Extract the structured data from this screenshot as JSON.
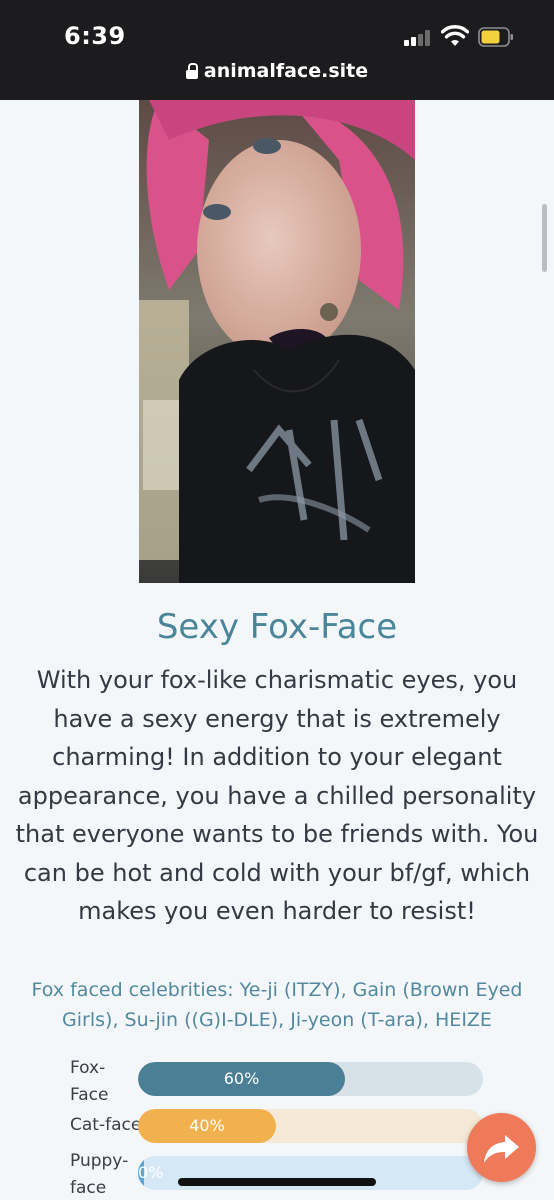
{
  "status_bar": {
    "time": "6:39"
  },
  "browser": {
    "url": "animalface.site"
  },
  "result": {
    "title": "Sexy Fox-Face",
    "description": "With your fox-like charismatic eyes, you have a sexy energy that is extremely charming! In addition to your elegant appearance, you have a chilled personality that everyone wants to be friends with. You can be hot and cold with your bf/gf, which makes you even harder to resist!",
    "celebrities": "Fox faced celebrities: Ye-ji (ITZY), Gain (Brown Eyed Girls), Su-jin ((G)I-DLE), Ji-yeon (T-ara), HEIZE"
  },
  "bars": [
    {
      "label": "Fox-Face",
      "percent_label": "60%",
      "fraction": 0.6,
      "fill_color": "#4a7f95",
      "track_color": "#d7e1e8"
    },
    {
      "label": "Cat-face",
      "percent_label": "40%",
      "fraction": 0.4,
      "fill_color": "#f0b14e",
      "track_color": "#f6e8d6"
    },
    {
      "label": "Puppy-face",
      "percent_label": "0%",
      "fraction": 0.01,
      "fill_color": "#5aa7d8",
      "track_color": "#d5e8f5"
    }
  ],
  "colors": {
    "title": "#4a859a",
    "celebrities_text": "#5389a0",
    "share_button": "#ef7a5a"
  },
  "icons": {
    "lock": "lock-icon",
    "signal": "cellular-signal-icon",
    "wifi": "wifi-icon",
    "battery": "battery-icon",
    "share": "share-arrow-icon"
  }
}
